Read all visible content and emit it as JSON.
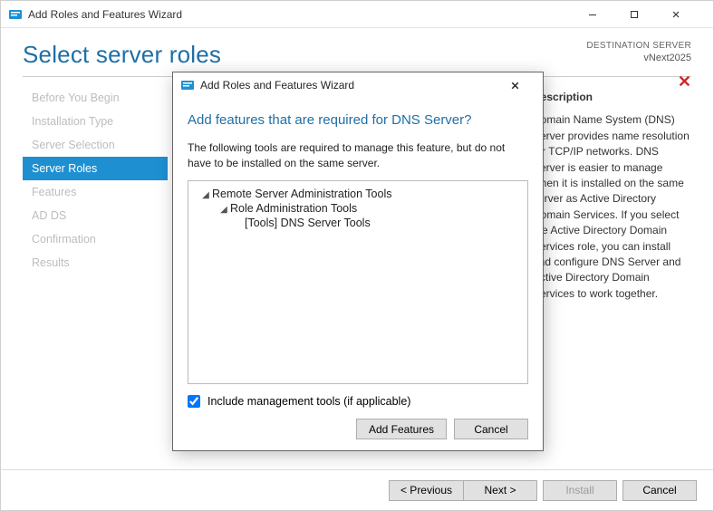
{
  "window": {
    "title": "Add Roles and Features Wizard"
  },
  "page": {
    "heading": "Select server roles",
    "destination_label": "DESTINATION SERVER",
    "destination_value": "vNext2025",
    "error_glyph": "✕"
  },
  "nav": {
    "items": [
      {
        "label": "Before You Begin"
      },
      {
        "label": "Installation Type"
      },
      {
        "label": "Server Selection"
      },
      {
        "label": "Server Roles",
        "active": true
      },
      {
        "label": "Features"
      },
      {
        "label": "AD DS"
      },
      {
        "label": "Confirmation"
      },
      {
        "label": "Results"
      }
    ]
  },
  "description": {
    "heading": "Description",
    "text": "Domain Name System (DNS) Server provides name resolution for TCP/IP networks. DNS Server is easier to manage when it is installed on the same server as Active Directory Domain Services. If you select the Active Directory Domain Services role, you can install and configure DNS Server and Active Directory Domain Services to work together."
  },
  "footer": {
    "previous": "< Previous",
    "next": "Next >",
    "install": "Install",
    "cancel": "Cancel"
  },
  "dialog": {
    "title": "Add Roles and Features Wizard",
    "question": "Add features that are required for DNS Server?",
    "explain": "The following tools are required to manage this feature, but do not have to be installed on the same server.",
    "tree": {
      "l1": "Remote Server Administration Tools",
      "l2": "Role Administration Tools",
      "l3": "[Tools] DNS Server Tools"
    },
    "include_mgmt_label": "Include management tools (if applicable)",
    "include_mgmt_checked": true,
    "add_features": "Add Features",
    "cancel": "Cancel"
  }
}
